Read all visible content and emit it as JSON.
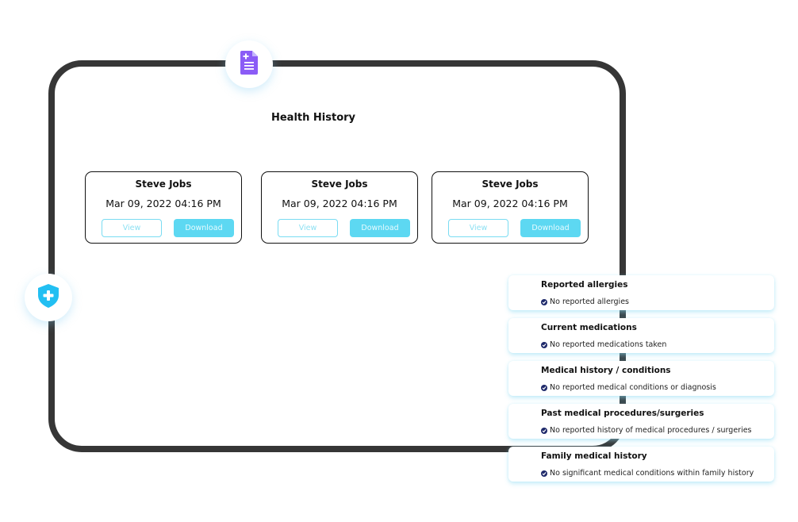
{
  "page": {
    "title": "Health History"
  },
  "icons": {
    "top": "medical-document-icon",
    "left": "shield-plus-icon"
  },
  "colors": {
    "frame": "#363636",
    "accent": "#5dd8f2",
    "doc_icon": "#8b5cf6",
    "shield_icon": "#22bff2",
    "check": "#1f2a6b"
  },
  "records": [
    {
      "name": "Steve Jobs",
      "date": "Mar 09, 2022 04:16 PM",
      "view_label": "View",
      "download_label": "Download"
    },
    {
      "name": "Steve Jobs",
      "date": "Mar 09, 2022 04:16 PM",
      "view_label": "View",
      "download_label": "Download"
    },
    {
      "name": "Steve Jobs",
      "date": "Mar 09, 2022 04:16 PM",
      "view_label": "View",
      "download_label": "Download"
    }
  ],
  "summary": [
    {
      "heading": "Reported allergies",
      "status": "No reported allergies"
    },
    {
      "heading": "Current medications",
      "status": "No reported medications taken"
    },
    {
      "heading": "Medical history / conditions",
      "status": "No reported medical conditions or diagnosis"
    },
    {
      "heading": "Past medical procedures/surgeries",
      "status": "No reported history of medical procedures / surgeries"
    },
    {
      "heading": "Family medical history",
      "status": "No significant medical conditions within family history"
    }
  ]
}
